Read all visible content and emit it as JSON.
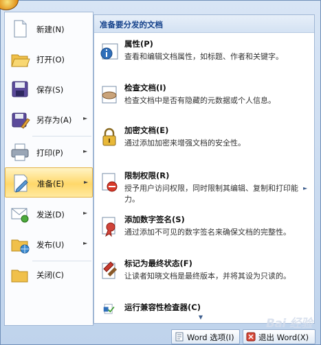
{
  "menu": {
    "commands": [
      {
        "label": "新建(N)",
        "icon": "new-document-icon",
        "arrow": ""
      },
      {
        "label": "打开(O)",
        "icon": "open-folder-icon",
        "arrow": ""
      },
      {
        "label": "保存(S)",
        "icon": "save-disk-icon",
        "arrow": ""
      },
      {
        "label": "另存为(A)",
        "icon": "save-as-icon",
        "arrow": "►"
      },
      {
        "label": "打印(P)",
        "icon": "printer-icon",
        "arrow": "►"
      },
      {
        "label": "准备(E)",
        "icon": "prepare-icon",
        "arrow": "►"
      },
      {
        "label": "发送(D)",
        "icon": "send-icon",
        "arrow": "►"
      },
      {
        "label": "发布(U)",
        "icon": "publish-icon",
        "arrow": "►"
      },
      {
        "label": "关闭(C)",
        "icon": "close-folder-icon",
        "arrow": ""
      }
    ],
    "active_index": 5
  },
  "panel": {
    "title": "准备要分发的文档",
    "items": [
      {
        "title": "属性(P)",
        "desc": "查看和编辑文档属性，如标题、作者和关键字。",
        "icon": "properties-icon"
      },
      {
        "title": "检查文档(I)",
        "desc": "检查文档中是否有隐藏的元数据或个人信息。",
        "icon": "inspect-document-icon"
      },
      {
        "title": "加密文档(E)",
        "desc": "通过添加加密来增强文档的安全性。",
        "icon": "encrypt-lock-icon"
      },
      {
        "title": "限制权限(R)",
        "desc": "授予用户访问权限，同时限制其编辑、复制和打印能力。",
        "icon": "restrict-permission-icon"
      },
      {
        "title": "添加数字签名(S)",
        "desc": "通过添加不可见的数字签名来确保文档的完整性。",
        "icon": "digital-signature-icon"
      },
      {
        "title": "标记为最终状态(F)",
        "desc": "让读者知晓文档是最终版本，并将其设为只读的。",
        "icon": "mark-final-icon"
      },
      {
        "title": "运行兼容性检查器(C)",
        "desc": "",
        "icon": "compatibility-checker-icon"
      }
    ],
    "scroll_right_glyph": "►",
    "scroll_down_glyph": "▼"
  },
  "footer": {
    "options_label": "Word 选项(I)",
    "exit_label": "退出 Word(X)"
  },
  "watermark": "Bai 经验"
}
